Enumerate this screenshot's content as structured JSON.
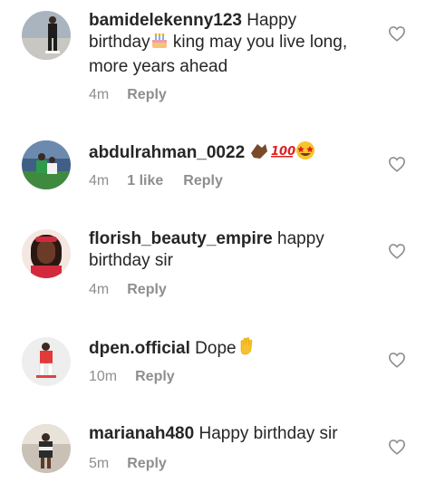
{
  "colors": {
    "text": "#262626",
    "meta": "#8e8e8e",
    "heart_outline": "#8e8e8e"
  },
  "comments": [
    {
      "username": "bamidelekenny123",
      "text_before_emoji": " Happy birthday",
      "emoji": "birthday-cake-emoji",
      "text_after_emoji": " king may you live long, more years ahead",
      "time": "4m",
      "likes": "",
      "reply_label": "Reply"
    },
    {
      "username": "abdulrahman_0022",
      "text_before_emoji": " ",
      "emoji": "clap-hands-100-star-eyes-emoji",
      "text_after_emoji": "",
      "time": "4m",
      "likes": "1 like",
      "reply_label": "Reply"
    },
    {
      "username": "florish_beauty_empire",
      "text_before_emoji": " happy birthday sir",
      "emoji": "",
      "text_after_emoji": "",
      "time": "4m",
      "likes": "",
      "reply_label": "Reply"
    },
    {
      "username": "dpen.official",
      "text_before_emoji": " Dope",
      "emoji": "waving-hand-emoji",
      "text_after_emoji": "",
      "time": "10m",
      "likes": "",
      "reply_label": "Reply"
    },
    {
      "username": "marianah480",
      "text_before_emoji": " Happy birthday sir",
      "emoji": "",
      "text_after_emoji": "",
      "time": "5m",
      "likes": "",
      "reply_label": "Reply"
    }
  ]
}
